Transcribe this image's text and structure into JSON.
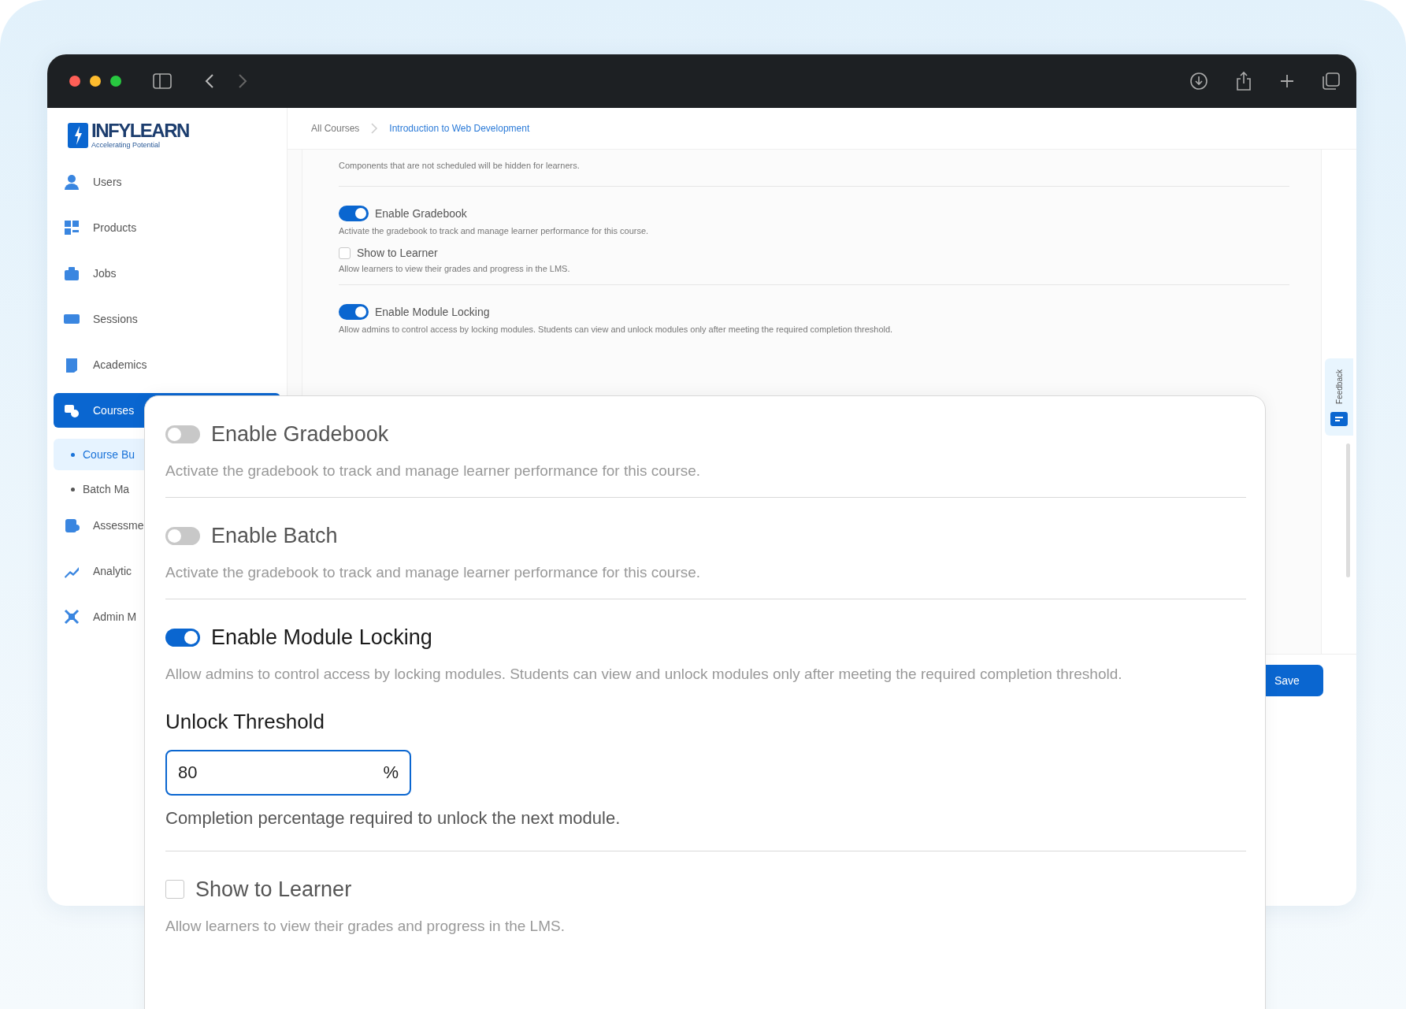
{
  "sidebar": {
    "logo": {
      "name": "INFYLEARN",
      "tagline": "Accelerating Potential"
    },
    "items": [
      {
        "label": "Users",
        "selected": false
      },
      {
        "label": "Products",
        "selected": false
      },
      {
        "label": "Jobs",
        "selected": false
      },
      {
        "label": "Sessions",
        "selected": false
      },
      {
        "label": "Academics",
        "selected": false
      },
      {
        "label": "Courses",
        "selected": true,
        "children": [
          {
            "label": "Course Bu",
            "selected": true
          },
          {
            "label": "Batch Ma",
            "selected": false
          }
        ]
      },
      {
        "label": "Assessme",
        "selected": false
      },
      {
        "label": "Analytic",
        "selected": false
      },
      {
        "label": "Admin M",
        "selected": false
      }
    ]
  },
  "breadcrumb": [
    "All Courses",
    "Introduction to Web Development"
  ],
  "background_settings": {
    "note": "Components that are not scheduled will be hidden for learners.",
    "items": [
      {
        "kind": "toggle",
        "label": "Enable Gradebook",
        "on": true,
        "description": "Activate the gradebook to track and manage learner performance for this course."
      },
      {
        "kind": "checkbox",
        "label": "Show to Learner",
        "checked": false,
        "description": "Allow learners to view their grades and progress in the LMS."
      },
      {
        "kind": "toggle",
        "label": "Enable Module Locking",
        "on": true,
        "description": "Allow admins to control access by locking modules. Students can view and unlock modules only after meeting the required completion threshold."
      }
    ]
  },
  "feedback_tab": "Feedback",
  "save_button": "Save",
  "settings_card": {
    "items": [
      {
        "kind": "toggle",
        "label": "Enable Gradebook",
        "on": false,
        "description": "Activate the gradebook to track and manage learner performance for this course."
      },
      {
        "kind": "toggle",
        "label": "Enable Batch",
        "on": false,
        "description": "Activate the gradebook to track and manage learner performance for this course."
      },
      {
        "kind": "toggle",
        "label": "Enable Module Locking",
        "on": true,
        "description": "Allow admins to control access by locking modules. Students can view and unlock modules only after meeting the required completion threshold.",
        "threshold": {
          "label": "Unlock Threshold",
          "value": "80",
          "suffix": "%",
          "hint": "Completion percentage required to unlock the next module."
        }
      },
      {
        "kind": "checkbox",
        "label": "Show to Learner",
        "checked": false,
        "description": "Allow learners to view their grades and progress in the LMS."
      }
    ]
  }
}
